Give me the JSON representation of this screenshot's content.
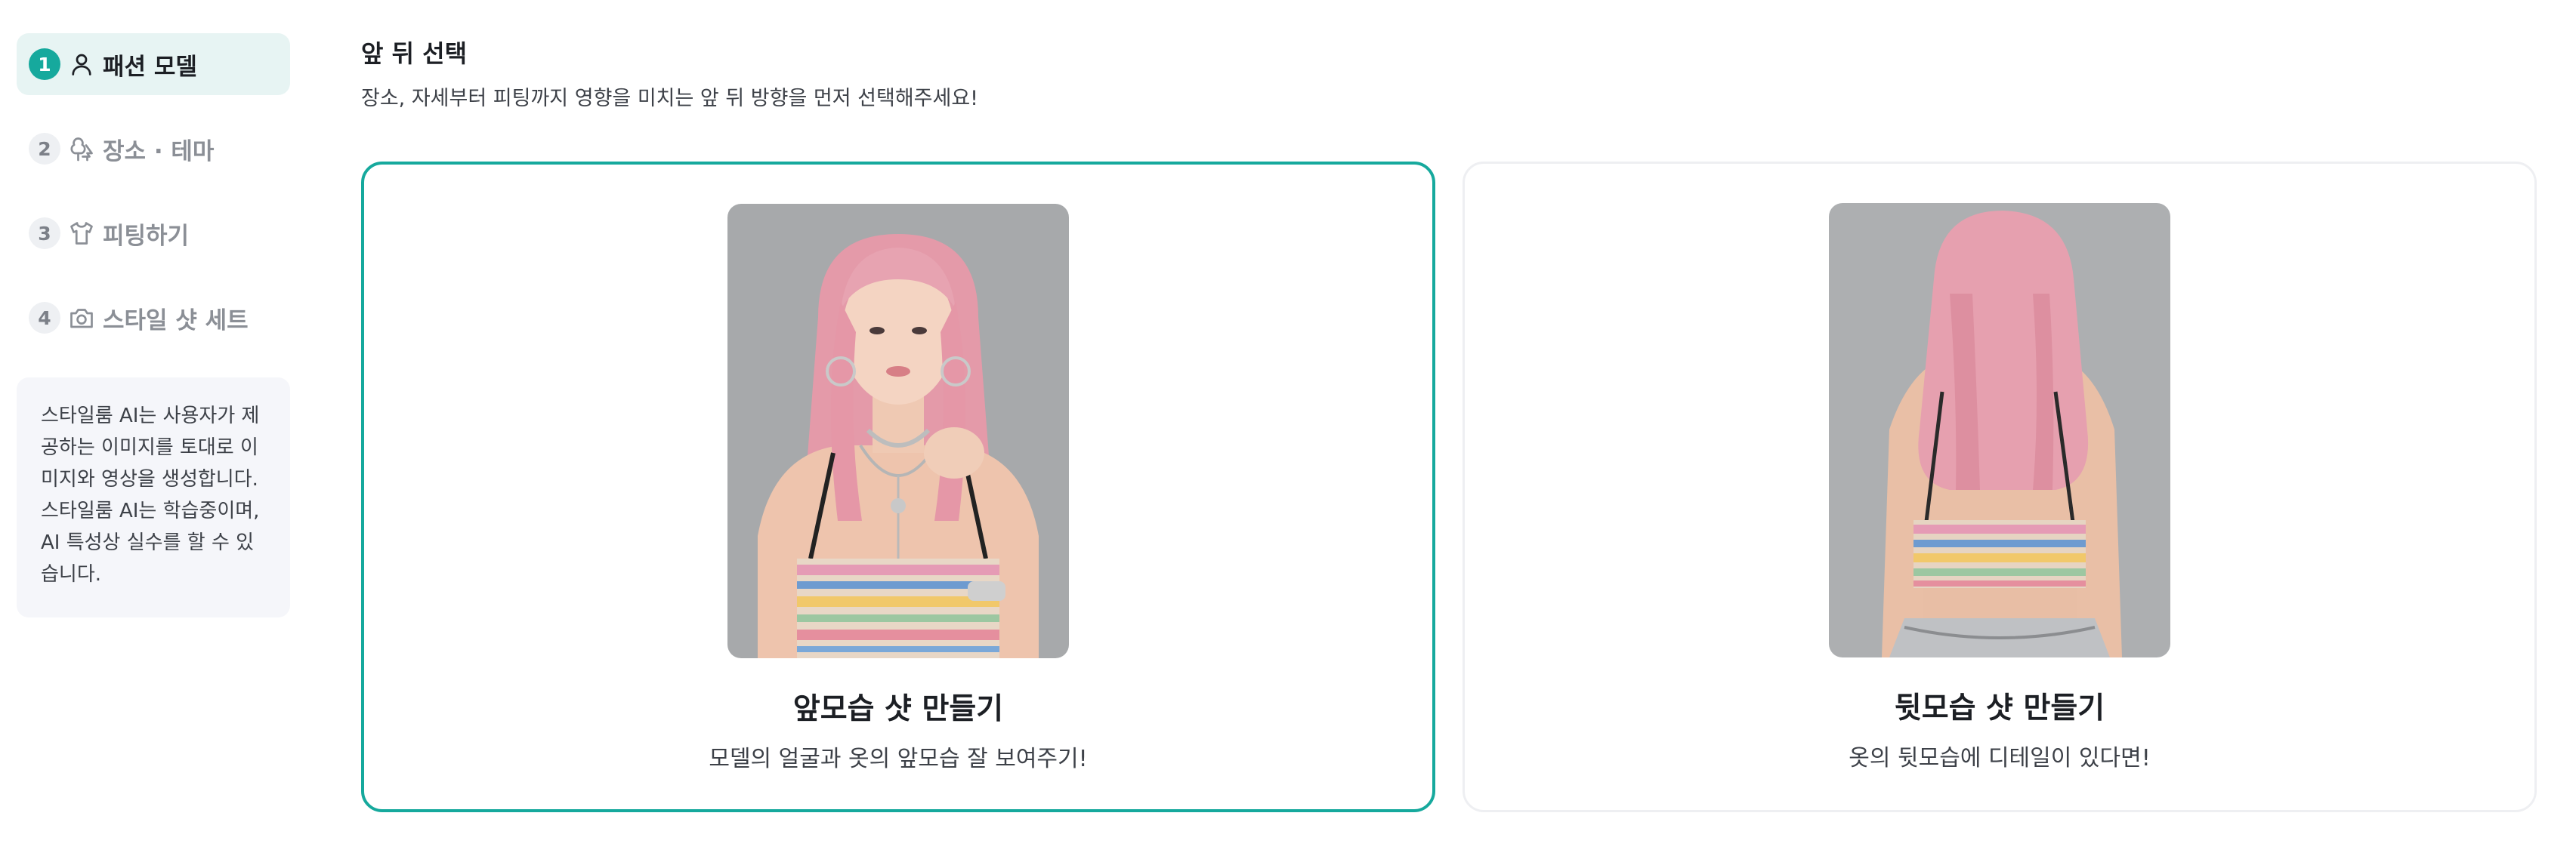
{
  "sidebar": {
    "steps": [
      {
        "number": "1",
        "label": "패션 모델",
        "icon": "person-icon",
        "active": true
      },
      {
        "number": "2",
        "label": "장소 · 테마",
        "icon": "trees-icon",
        "active": false
      },
      {
        "number": "3",
        "label": "피팅하기",
        "icon": "shirt-icon",
        "active": false
      },
      {
        "number": "4",
        "label": "스타일 샷 세트",
        "icon": "camera-icon",
        "active": false
      }
    ],
    "notice": "스타일룸 AI는 사용자가 제공하는 이미지를 토대로 이미지와 영상을 생성합니다. 스타일룸 AI는 학습중이며, AI 특성상 실수를 할 수 있습니다."
  },
  "main": {
    "title": "앞 뒤 선택",
    "subtitle": "장소, 자세부터 피팅까지 영향을 미치는 앞 뒤 방향을 먼저 선택해주세요!",
    "options": [
      {
        "title": "앞모습 샷 만들기",
        "description": "모델의 얼굴과 옷의 앞모습 잘 보여주기!",
        "selected": true
      },
      {
        "title": "뒷모습 샷 만들기",
        "description": "옷의 뒷모습에 디테일이 있다면!",
        "selected": false
      }
    ]
  },
  "colors": {
    "accent": "#16a99d",
    "active_bg": "#e7f4f3",
    "notice_bg": "#f5f6fa"
  }
}
